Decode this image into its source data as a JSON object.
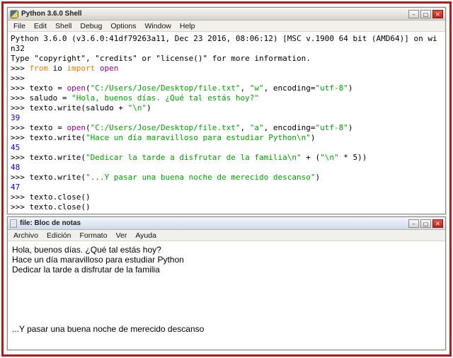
{
  "controls": {
    "minimize": "–",
    "maximize": "□",
    "close": "✕"
  },
  "colors": {
    "frame_border": "#b21a1a",
    "keyword": "#ff7700",
    "builtin": "#900090",
    "string": "#00a000",
    "output": "#0000ff",
    "close_button": "#b8281c"
  },
  "shell": {
    "title": "Python 3.6.0 Shell",
    "menu": [
      "File",
      "Edit",
      "Shell",
      "Debug",
      "Options",
      "Window",
      "Help"
    ],
    "lines": [
      {
        "seg": [
          [
            "p",
            "Python 3.6.0 (v3.6.0:41df79263a11, Dec 23 2016, 08:06:12) [MSC v.1900 64 bit (AMD64)] on wi"
          ]
        ]
      },
      {
        "seg": [
          [
            "p",
            "n32"
          ]
        ]
      },
      {
        "seg": [
          [
            "p",
            "Type \"copyright\", \"credits\" or \"license()\" for more information."
          ]
        ]
      },
      {
        "seg": [
          [
            "p",
            ">>> "
          ],
          [
            "k",
            "from"
          ],
          [
            "p",
            " io "
          ],
          [
            "k",
            "import"
          ],
          [
            "p",
            " "
          ],
          [
            "b",
            "open"
          ]
        ]
      },
      {
        "seg": [
          [
            "p",
            ">>>"
          ]
        ]
      },
      {
        "seg": [
          [
            "p",
            ">>> texto = "
          ],
          [
            "b",
            "open"
          ],
          [
            "p",
            "("
          ],
          [
            "s",
            "\"C:/Users/Jose/Desktop/file.txt\""
          ],
          [
            "p",
            ", "
          ],
          [
            "s",
            "\"w\""
          ],
          [
            "p",
            ", encoding="
          ],
          [
            "s",
            "\"utf-8\""
          ],
          [
            "p",
            ")"
          ]
        ]
      },
      {
        "seg": [
          [
            "p",
            ">>> saludo = "
          ],
          [
            "s",
            "\"Hola, buenos días. ¿Qué tal estás hoy?\""
          ]
        ]
      },
      {
        "seg": [
          [
            "p",
            ">>> texto.write(saludo + "
          ],
          [
            "s",
            "\"\\n\""
          ],
          [
            "p",
            ")"
          ]
        ]
      },
      {
        "seg": [
          [
            "o",
            "39"
          ]
        ]
      },
      {
        "seg": [
          [
            "p",
            ">>> texto = "
          ],
          [
            "b",
            "open"
          ],
          [
            "p",
            "("
          ],
          [
            "s",
            "\"C:/Users/Jose/Desktop/file.txt\""
          ],
          [
            "p",
            ", "
          ],
          [
            "s",
            "\"a\""
          ],
          [
            "p",
            ", encoding="
          ],
          [
            "s",
            "\"utf-8\""
          ],
          [
            "p",
            ")"
          ]
        ]
      },
      {
        "seg": [
          [
            "p",
            ">>> texto.write("
          ],
          [
            "s",
            "\"Hace un día maravilloso para estudiar Python\\n\""
          ],
          [
            "p",
            ")"
          ]
        ]
      },
      {
        "seg": [
          [
            "o",
            "45"
          ]
        ]
      },
      {
        "seg": [
          [
            "p",
            ">>> texto.write("
          ],
          [
            "s",
            "\"Dedicar la tarde a disfrutar de la familia\\n\""
          ],
          [
            "p",
            " + ("
          ],
          [
            "s",
            "\"\\n\""
          ],
          [
            "p",
            " * 5))"
          ]
        ]
      },
      {
        "seg": [
          [
            "o",
            "48"
          ]
        ]
      },
      {
        "seg": [
          [
            "p",
            ">>> texto.write("
          ],
          [
            "s",
            "\"...Y pasar una buena noche de merecido descanso\""
          ],
          [
            "p",
            ")"
          ]
        ]
      },
      {
        "seg": [
          [
            "o",
            "47"
          ]
        ]
      },
      {
        "seg": [
          [
            "p",
            ">>> texto.close()"
          ]
        ]
      },
      {
        "seg": [
          [
            "p",
            ">>> texto.close()"
          ]
        ]
      }
    ]
  },
  "notepad": {
    "title": "file: Bloc de notas",
    "menu": [
      "Archivo",
      "Edición",
      "Formato",
      "Ver",
      "Ayuda"
    ],
    "lines": [
      "Hola, buenos días. ¿Qué tal estás hoy?",
      "Hace un día maravilloso para estudiar Python",
      "Dedicar la tarde a disfrutar de la familia",
      "",
      "",
      "",
      "",
      "",
      "...Y pasar una buena noche de merecido descanso"
    ]
  }
}
